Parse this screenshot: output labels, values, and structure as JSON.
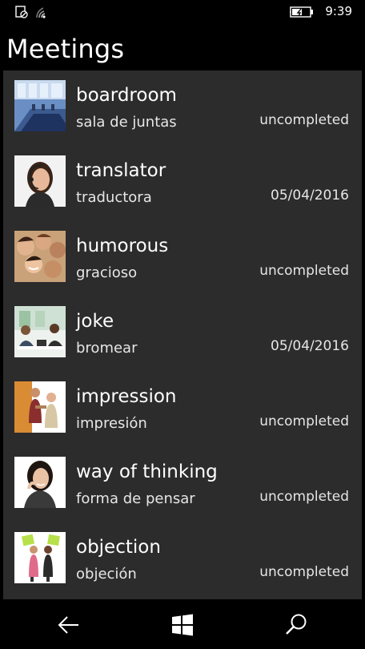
{
  "status_bar": {
    "time": "9:39",
    "icons": [
      "notification-icon",
      "wifi-icon",
      "battery-charging-icon"
    ]
  },
  "page": {
    "title": "Meetings"
  },
  "items": [
    {
      "title": "boardroom",
      "subtitle": "sala de juntas",
      "status": "uncompleted",
      "image": "boardroom-photo"
    },
    {
      "title": "translator",
      "subtitle": "traductora",
      "status": "05/04/2016",
      "image": "translator-photo"
    },
    {
      "title": "humorous",
      "subtitle": "gracioso",
      "status": "uncompleted",
      "image": "humorous-photo"
    },
    {
      "title": "joke",
      "subtitle": "bromear",
      "status": "05/04/2016",
      "image": "joke-photo"
    },
    {
      "title": "impression",
      "subtitle": "impresión",
      "status": "uncompleted",
      "image": "impression-photo"
    },
    {
      "title": "way of thinking",
      "subtitle": "forma de pensar",
      "status": "uncompleted",
      "image": "way-of-thinking-photo"
    },
    {
      "title": "objection",
      "subtitle": "objeción",
      "status": "uncompleted",
      "image": "objection-photo"
    }
  ],
  "nav": {
    "icons": [
      "back-arrow-icon",
      "windows-start-icon",
      "search-icon"
    ]
  },
  "colors": {
    "background": "#000000",
    "panel": "#2c2c2c",
    "text": "#ffffff"
  }
}
